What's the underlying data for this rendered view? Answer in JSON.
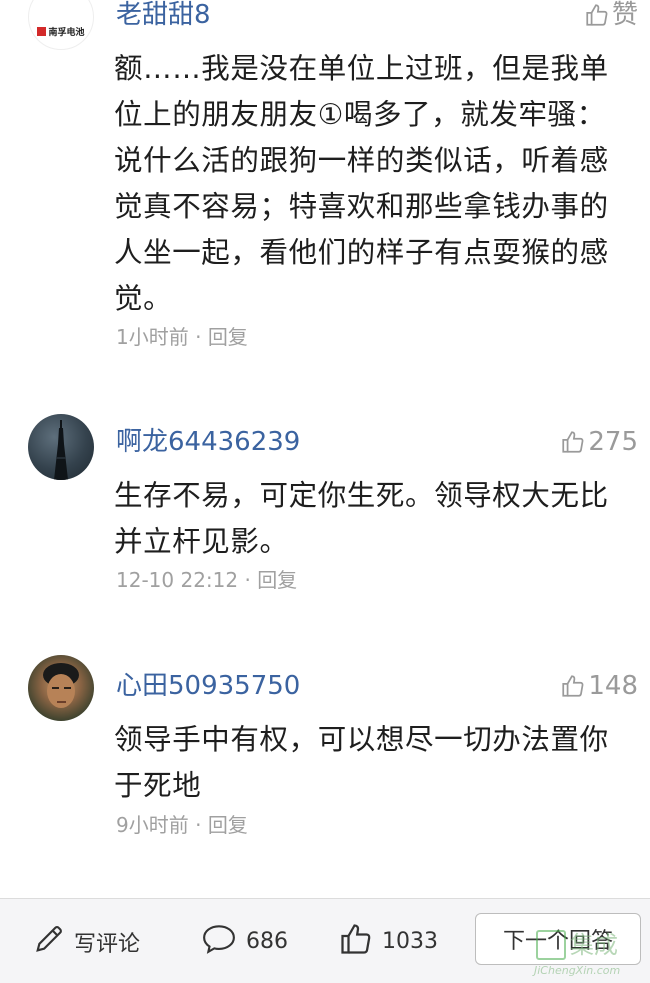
{
  "comments": [
    {
      "username": "老甜甜8",
      "avatar_text": "南孚电池",
      "like_label": "赞",
      "lines": [
        "额……我是没在单位上过班，但是我单",
        "位上的朋友朋友①喝多了，就发牢骚：",
        "说什么活的跟狗一样的类似话，听着感",
        "觉真不容易；特喜欢和那些拿钱办事的",
        "人坐一起，看他们的样子有点耍猴的感",
        "觉。"
      ],
      "time": "1小时前",
      "reply": "回复"
    },
    {
      "username": "啊龙64436239",
      "like_count": "275",
      "lines": [
        "生存不易，可定你生死。领导权大无比",
        "并立杆见影。"
      ],
      "time": "12-10 22:12",
      "reply": "回复"
    },
    {
      "username": "心田50935750",
      "like_count": "148",
      "lines": [
        "领导手中有权，可以想尽一切办法置你",
        "于死地"
      ],
      "time": "9小时前",
      "reply": "回复"
    }
  ],
  "separator": "·",
  "bottom_bar": {
    "write_label": "写评论",
    "comment_count": "686",
    "like_count": "1033",
    "next_label": "下一个回答"
  },
  "watermark": {
    "main": "集成",
    "sub": "JiChengXin.com"
  },
  "colors": {
    "username": "#3b63a0",
    "body": "#1e1e1e",
    "meta": "#a0a0a0",
    "bar_bg": "#f5f5f7"
  },
  "icons": {
    "thumb": "thumbs-up-icon",
    "pencil": "pencil-icon",
    "chat": "speech-bubble-icon"
  }
}
